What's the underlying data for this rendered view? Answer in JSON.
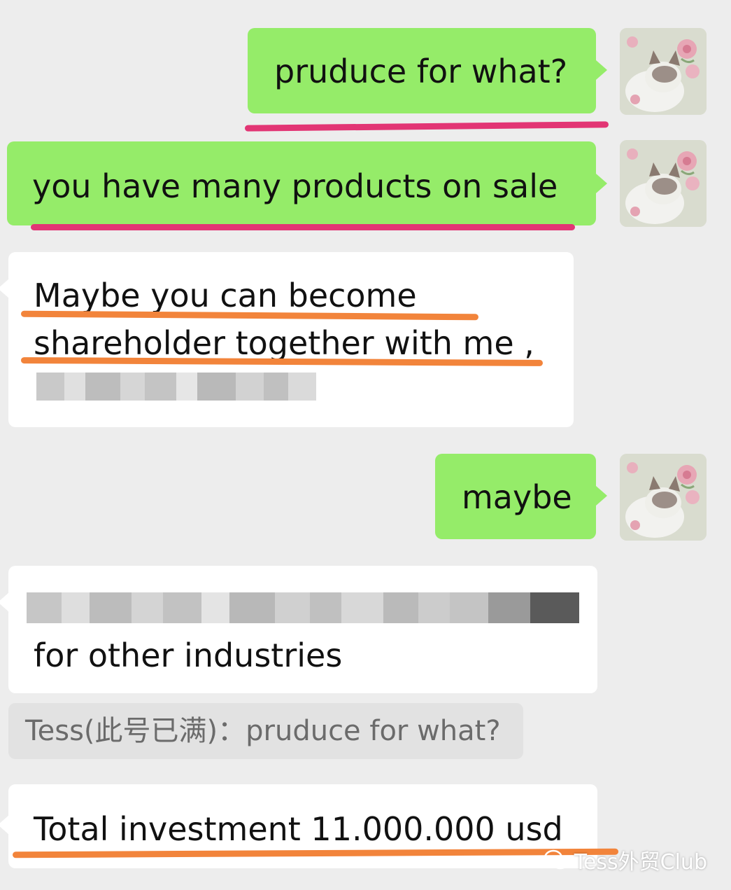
{
  "messages": [
    {
      "dir": "out",
      "lines": [
        "pruduce for what?"
      ]
    },
    {
      "dir": "out",
      "lines": [
        "you have many products on sale"
      ]
    },
    {
      "dir": "in",
      "lines": [
        "Maybe you can become",
        "shareholder together with me ,"
      ]
    },
    {
      "dir": "out",
      "lines": [
        "maybe"
      ]
    },
    {
      "dir": "in",
      "lines": [
        "for other industries"
      ]
    },
    {
      "dir": "in",
      "lines": [
        "Total investment 11.000.000 usd"
      ]
    }
  ],
  "quote": {
    "text": "Tess(此号已满)：pruduce for what?"
  },
  "avatar": {
    "icon": "cat-with-peony-avatar"
  },
  "watermark": {
    "text": "Tess外贸Club",
    "icon": "wechat-icon"
  },
  "colors": {
    "outgoing": "#95ec69",
    "incoming": "#ffffff",
    "underline_pink": "#e23574",
    "underline_orange": "#f2843b"
  }
}
